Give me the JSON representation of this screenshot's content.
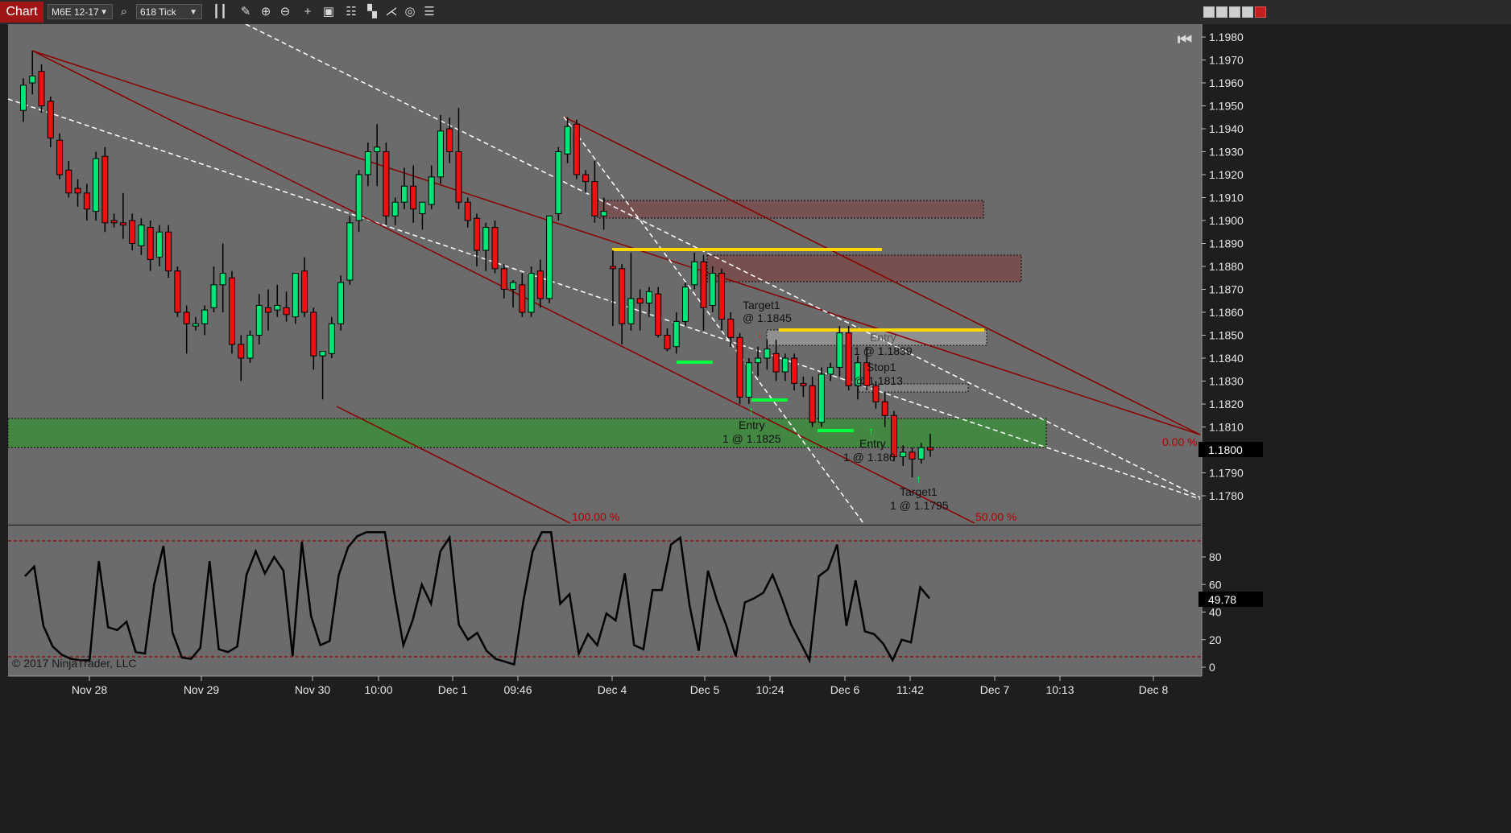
{
  "toolbar": {
    "chart_tab": "Chart",
    "instrument": "M6E 12-17",
    "period": "618 Tick",
    "icons": [
      "search-icon",
      "bar-type-icon",
      "pencil-icon",
      "zoom-in-icon",
      "zoom-out-icon",
      "crosshair-icon",
      "properties-icon",
      "indicators-icon",
      "strategies-icon",
      "drawing-tools-icon",
      "refresh-icon",
      "list-icon"
    ]
  },
  "colors": {
    "background": "#6b6b6b",
    "up_candle": "#00e676",
    "down_candle": "#ee1111",
    "channel_line": "#8b0000",
    "dashed_line": "#ffffff",
    "level_line": "#ffd600",
    "green_zone": "#3c8c3c",
    "red_zone": "#7a4a4a",
    "oscillator_line": "#000000",
    "chart_tab": "#a01616"
  },
  "chart_data": [
    {
      "type": "candlestick",
      "title": "",
      "instrument": "M6E 12-17",
      "ylim": [
        1.1772,
        1.1986
      ],
      "y_ticks": [
        "1.1980",
        "1.1970",
        "1.1960",
        "1.1950",
        "1.1940",
        "1.1930",
        "1.1920",
        "1.1910",
        "1.1900",
        "1.1890",
        "1.1880",
        "1.1870",
        "1.1860",
        "1.1850",
        "1.1840",
        "1.1830",
        "1.1820",
        "1.1810",
        "1.1800",
        "1.1790",
        "1.1780"
      ],
      "x_labels": [
        "Nov 28",
        "Nov 29",
        "Nov 30",
        "10:00",
        "Dec 1",
        "09:46",
        "Dec 4",
        "Dec 5",
        "10:24",
        "Dec 6",
        "11:42",
        "Dec 7",
        "10:13",
        "Dec 8"
      ],
      "last_price": "1.1800",
      "bars": [
        [
          1.1948,
          1.1962,
          1.1943,
          1.1959
        ],
        [
          1.196,
          1.1974,
          1.1955,
          1.1963
        ],
        [
          1.1965,
          1.1968,
          1.1947,
          1.195
        ],
        [
          1.1952,
          1.1954,
          1.1932,
          1.1936
        ],
        [
          1.1935,
          1.1938,
          1.1918,
          1.192
        ],
        [
          1.1922,
          1.1926,
          1.191,
          1.1912
        ],
        [
          1.1914,
          1.1918,
          1.1906,
          1.1912
        ],
        [
          1.1912,
          1.1916,
          1.19,
          1.1905
        ],
        [
          1.1904,
          1.193,
          1.19,
          1.1927
        ],
        [
          1.1928,
          1.1932,
          1.1895,
          1.1899
        ],
        [
          1.19,
          1.1903,
          1.1897,
          1.1899
        ],
        [
          1.1899,
          1.1912,
          1.1892,
          1.1898
        ],
        [
          1.19,
          1.1903,
          1.1887,
          1.189
        ],
        [
          1.1889,
          1.1901,
          1.1885,
          1.1898
        ],
        [
          1.1897,
          1.19,
          1.1878,
          1.1883
        ],
        [
          1.1884,
          1.1898,
          1.188,
          1.1895
        ],
        [
          1.1895,
          1.1898,
          1.1875,
          1.1878
        ],
        [
          1.1878,
          1.188,
          1.1858,
          1.186
        ],
        [
          1.186,
          1.1863,
          1.1842,
          1.1855
        ],
        [
          1.1854,
          1.1858,
          1.1852,
          1.1855
        ],
        [
          1.1855,
          1.1863,
          1.185,
          1.1861
        ],
        [
          1.1862,
          1.188,
          1.186,
          1.1872
        ],
        [
          1.1872,
          1.189,
          1.186,
          1.1877
        ],
        [
          1.1875,
          1.1878,
          1.1842,
          1.1846
        ],
        [
          1.1846,
          1.185,
          1.183,
          1.184
        ],
        [
          1.184,
          1.1852,
          1.1838,
          1.185
        ],
        [
          1.185,
          1.1868,
          1.1846,
          1.1863
        ],
        [
          1.1862,
          1.187,
          1.1852,
          1.186
        ],
        [
          1.1861,
          1.1872,
          1.1858,
          1.1863
        ],
        [
          1.1862,
          1.1869,
          1.1856,
          1.1859
        ],
        [
          1.1858,
          1.1875,
          1.1855,
          1.1877
        ],
        [
          1.1878,
          1.1884,
          1.1858,
          1.186
        ],
        [
          1.186,
          1.1862,
          1.1835,
          1.1841
        ],
        [
          1.1841,
          1.1843,
          1.1822,
          1.1843
        ],
        [
          1.1842,
          1.1858,
          1.184,
          1.1855
        ],
        [
          1.1855,
          1.1876,
          1.1852,
          1.1873
        ],
        [
          1.1874,
          1.1902,
          1.1872,
          1.1899
        ],
        [
          1.19,
          1.1922,
          1.1895,
          1.192
        ],
        [
          1.192,
          1.1934,
          1.1915,
          1.193
        ],
        [
          1.193,
          1.1942,
          1.1915,
          1.1932
        ],
        [
          1.193,
          1.1934,
          1.1898,
          1.1902
        ],
        [
          1.1902,
          1.191,
          1.1898,
          1.1908
        ],
        [
          1.1908,
          1.1923,
          1.1905,
          1.1915
        ],
        [
          1.1915,
          1.1924,
          1.1899,
          1.1905
        ],
        [
          1.1903,
          1.1906,
          1.1896,
          1.1908
        ],
        [
          1.1907,
          1.1924,
          1.1905,
          1.1919
        ],
        [
          1.1919,
          1.1946,
          1.1916,
          1.1939
        ],
        [
          1.194,
          1.1945,
          1.1925,
          1.193
        ],
        [
          1.193,
          1.1949,
          1.1905,
          1.1908
        ],
        [
          1.1908,
          1.191,
          1.1897,
          1.19
        ],
        [
          1.1901,
          1.1903,
          1.188,
          1.1887
        ],
        [
          1.1887,
          1.1899,
          1.1878,
          1.1897
        ],
        [
          1.1897,
          1.19,
          1.1877,
          1.1879
        ],
        [
          1.1879,
          1.1881,
          1.1866,
          1.187
        ],
        [
          1.187,
          1.1874,
          1.1862,
          1.1873
        ],
        [
          1.1872,
          1.1877,
          1.1858,
          1.186
        ],
        [
          1.186,
          1.188,
          1.1858,
          1.1877
        ],
        [
          1.1878,
          1.1883,
          1.1862,
          1.1866
        ],
        [
          1.1866,
          1.1902,
          1.1864,
          1.1902
        ],
        [
          1.1903,
          1.1932,
          1.19,
          1.193
        ],
        [
          1.1929,
          1.1945,
          1.1925,
          1.1941
        ],
        [
          1.1942,
          1.1944,
          1.1918,
          1.192
        ],
        [
          1.192,
          1.1922,
          1.1912,
          1.1917
        ],
        [
          1.1917,
          1.1926,
          1.1899,
          1.1902
        ],
        [
          1.1902,
          1.191,
          1.1896,
          1.1904
        ],
        [
          1.188,
          1.1887,
          1.1854,
          1.1879
        ],
        [
          1.1879,
          1.1881,
          1.1846,
          1.1855
        ],
        [
          1.1855,
          1.1886,
          1.1852,
          1.1866
        ],
        [
          1.1866,
          1.187,
          1.1852,
          1.1864
        ],
        [
          1.1864,
          1.1871,
          1.1858,
          1.1869
        ],
        [
          1.1868,
          1.1871,
          1.1849,
          1.185
        ],
        [
          1.185,
          1.1853,
          1.1843,
          1.1844
        ],
        [
          1.1845,
          1.186,
          1.1842,
          1.1856
        ],
        [
          1.1856,
          1.1873,
          1.1854,
          1.1871
        ],
        [
          1.1872,
          1.1886,
          1.187,
          1.1882
        ],
        [
          1.1882,
          1.1885,
          1.1852,
          1.1862
        ],
        [
          1.1863,
          1.188,
          1.186,
          1.1877
        ],
        [
          1.1877,
          1.1879,
          1.1852,
          1.1857
        ],
        [
          1.1857,
          1.186,
          1.1845,
          1.1849
        ],
        [
          1.1849,
          1.1851,
          1.182,
          1.1823
        ],
        [
          1.1823,
          1.184,
          1.182,
          1.1838
        ],
        [
          1.1838,
          1.1845,
          1.1832,
          1.184
        ],
        [
          1.184,
          1.1848,
          1.1835,
          1.1844
        ],
        [
          1.1842,
          1.1848,
          1.183,
          1.1834
        ],
        [
          1.1834,
          1.1842,
          1.183,
          1.184
        ],
        [
          1.184,
          1.1842,
          1.1826,
          1.1829
        ],
        [
          1.1829,
          1.1832,
          1.1823,
          1.1828
        ],
        [
          1.1828,
          1.1832,
          1.181,
          1.1812
        ],
        [
          1.1812,
          1.1836,
          1.181,
          1.1833
        ],
        [
          1.1833,
          1.1838,
          1.183,
          1.1836
        ],
        [
          1.1836,
          1.1854,
          1.1832,
          1.1851
        ],
        [
          1.1851,
          1.1854,
          1.1826,
          1.1828
        ],
        [
          1.1828,
          1.1841,
          1.1822,
          1.1838
        ],
        [
          1.1838,
          1.1845,
          1.1826,
          1.1828
        ],
        [
          1.1828,
          1.183,
          1.1818,
          1.1821
        ],
        [
          1.1821,
          1.1825,
          1.181,
          1.1815
        ],
        [
          1.1815,
          1.1817,
          1.1795,
          1.1797
        ],
        [
          1.1797,
          1.1802,
          1.1793,
          1.1799
        ],
        [
          1.1799,
          1.1801,
          1.1788,
          1.1796
        ],
        [
          1.1796,
          1.1803,
          1.1794,
          1.1801
        ],
        [
          1.1801,
          1.1807,
          1.1797,
          1.18
        ]
      ],
      "zones": [
        {
          "kind": "demand",
          "low": 1.18,
          "high": 1.1813
        },
        {
          "kind": "supply",
          "low": 1.1898,
          "high": 1.1906
        },
        {
          "kind": "supply",
          "low": 1.1871,
          "high": 1.1883
        }
      ],
      "levels": [
        1.1887,
        1.1852
      ],
      "annotations": [
        {
          "text": "Target1",
          "text2": "@ 1.1845"
        },
        {
          "text": "Entry",
          "text2": "1 @ 1.1839"
        },
        {
          "text": "Stop1",
          "text2": "@ 1.1813"
        },
        {
          "text": "Entry",
          "text2": "1 @ 1.1825"
        },
        {
          "text": "Entry",
          "text2": "1 @ 1.180"
        },
        {
          "text": "Target1",
          "text2": "1 @ 1.1795"
        }
      ],
      "fib_labels": [
        "100.00 %",
        "50.00 %",
        "0.00 %"
      ]
    },
    {
      "type": "line",
      "title": "",
      "ylim": [
        -3,
        98
      ],
      "y_ticks": [
        "80",
        "60",
        "40",
        "20",
        "0"
      ],
      "levels": [
        92,
        8
      ],
      "last_value": "49.78",
      "values": [
        66,
        73,
        30,
        15,
        9,
        6,
        5,
        5,
        77,
        29,
        27,
        33,
        11,
        10,
        60,
        88,
        25,
        7,
        6,
        14,
        77,
        13,
        11,
        15,
        67,
        84,
        68,
        80,
        70,
        8,
        91,
        37,
        16,
        19,
        67,
        87,
        95,
        98,
        98,
        98,
        54,
        16,
        34,
        60,
        46,
        84,
        94,
        31,
        20,
        25,
        12,
        6,
        4,
        2,
        48,
        84,
        98,
        98,
        46,
        53,
        10,
        24,
        16,
        39,
        34,
        68,
        16,
        13,
        56,
        56,
        89,
        94,
        45,
        12,
        70,
        48,
        30,
        8,
        47,
        50,
        54,
        67,
        50,
        31,
        18,
        5,
        66,
        71,
        89,
        30,
        63,
        26,
        24,
        17,
        5,
        20,
        18,
        58,
        50
      ]
    }
  ],
  "copyright": "© 2017 NinjaTrader, LLC"
}
